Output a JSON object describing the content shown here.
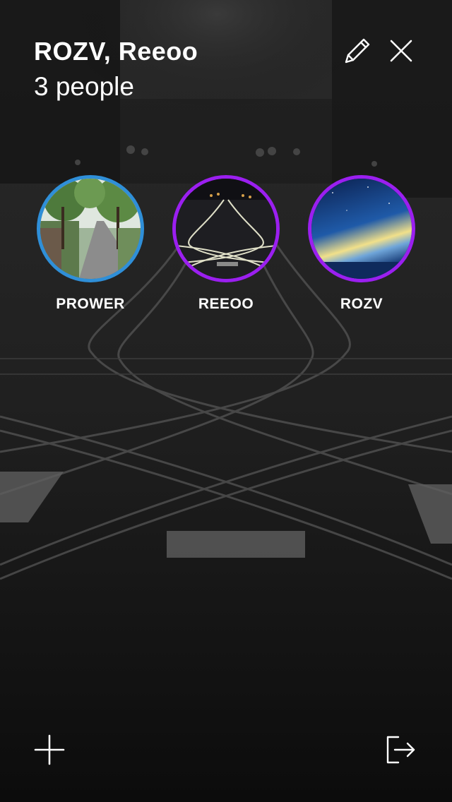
{
  "header": {
    "title": "ROZV, Reeoo",
    "subtitle": "3 people"
  },
  "toolbar": {
    "edit_icon": "pencil-icon",
    "close_icon": "close-icon",
    "add_icon": "plus-icon",
    "leave_icon": "exit-icon"
  },
  "members": [
    {
      "name": "PROWER",
      "ring_color": "#2f8fd8",
      "photo": "tree-lined street"
    },
    {
      "name": "REEOO",
      "ring_color": "#9b1ff0",
      "photo": "tram tracks at night"
    },
    {
      "name": "ROZV",
      "ring_color": "#9b1ff0",
      "photo": "starry sky over sea"
    }
  ],
  "colors": {
    "text": "#ffffff",
    "background": "#1c1c1c"
  }
}
